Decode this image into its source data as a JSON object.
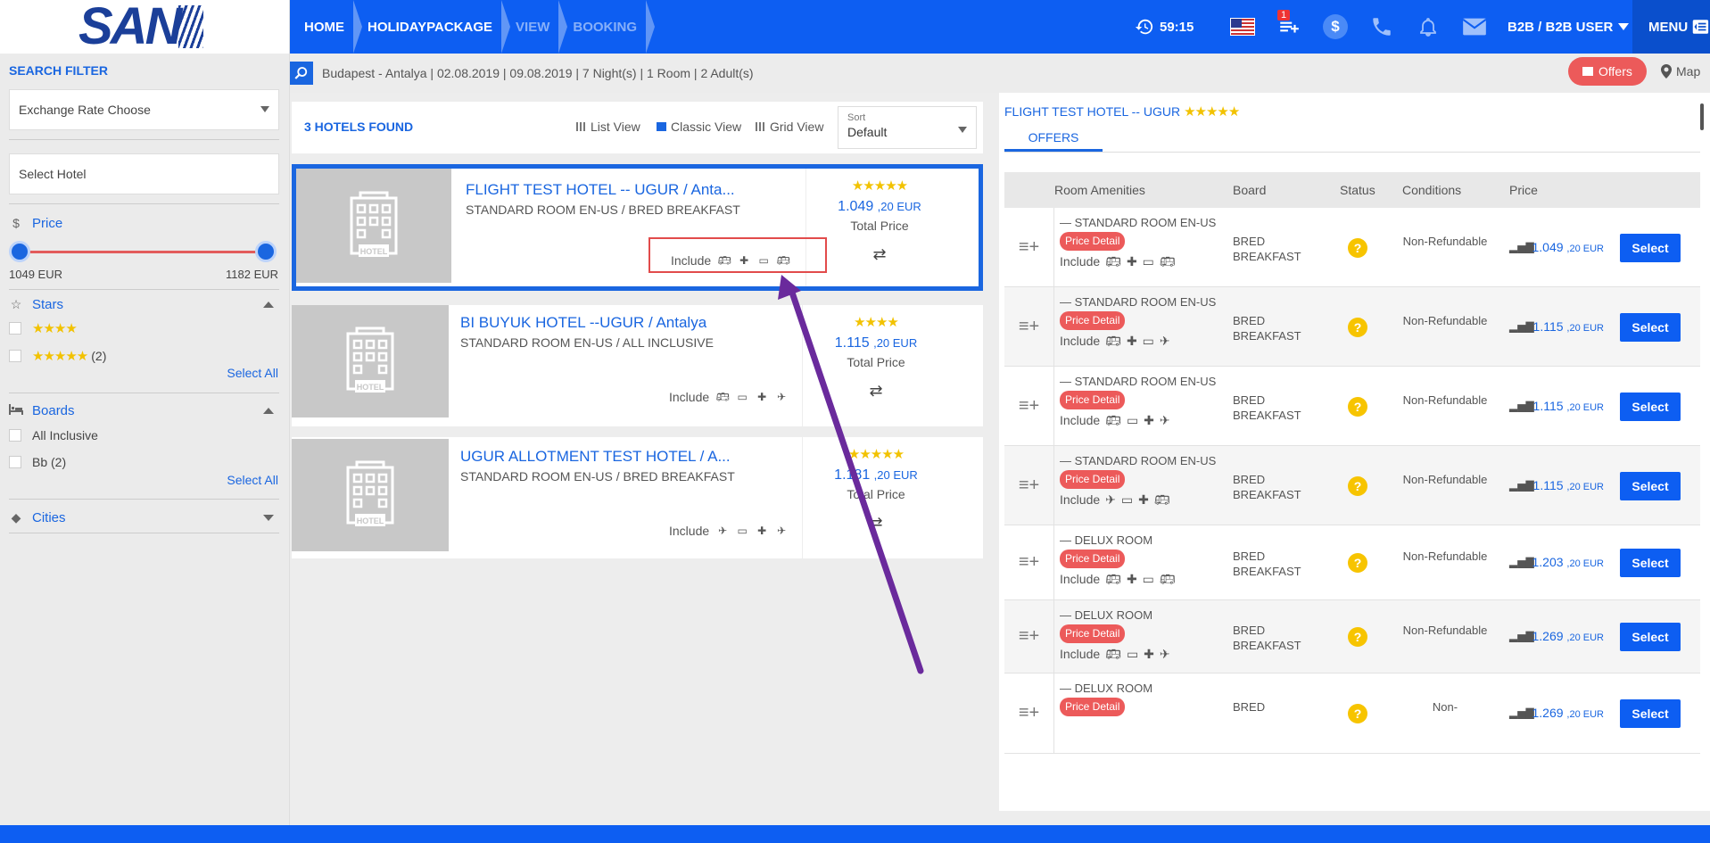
{
  "logo": "SAN",
  "breadcrumbs": [
    {
      "label": "HOME",
      "active": true
    },
    {
      "label": "HOLIDAYPACKAGE",
      "active": true
    },
    {
      "label": "VIEW",
      "active": false
    },
    {
      "label": "BOOKING",
      "active": false
    }
  ],
  "header": {
    "timer": "59:15",
    "cart_badge": "1",
    "user": "B2B / B2B USER",
    "menu": "MENU"
  },
  "sidebar": {
    "title": "SEARCH FILTER",
    "exchange_rate": "Exchange Rate Choose",
    "select_hotel": "Select Hotel",
    "price": {
      "label": "Price",
      "min": "1049 EUR",
      "max": "1182 EUR"
    },
    "stars": {
      "label": "Stars",
      "options": [
        {
          "stars": "★★★★",
          "count": ""
        },
        {
          "stars": "★★★★★",
          "count": "(2)"
        }
      ],
      "select_all": "Select All"
    },
    "boards": {
      "label": "Boards",
      "options": [
        {
          "label": "All Inclusive"
        },
        {
          "label": "Bb (2)"
        }
      ],
      "select_all": "Select All"
    },
    "cities": {
      "label": "Cities"
    }
  },
  "search_summary": "Budapest - Antalya | 02.08.2019 | 09.08.2019 | 7 Night(s) | 1 Room | 2 Adult(s)",
  "offers_button": "Offers",
  "map_button": "Map",
  "list": {
    "found": "3 HOTELS FOUND",
    "views": [
      "List View",
      "Classic View",
      "Grid View"
    ],
    "sort_label": "Sort",
    "sort_value": "Default",
    "include_label": "Include",
    "total_price": "Total Price",
    "hotel_placeholder": "HOTEL"
  },
  "hotels": [
    {
      "name": "FLIGHT TEST HOTEL -- UGUR / Anta...",
      "room": "STANDARD ROOM EN-US / BRED BREAKFAST",
      "stars": "★★★★★",
      "price": "1.049",
      "price_dec": ",20 EUR",
      "icons": [
        "bus-icon",
        "medical-icon",
        "van-icon",
        "bus-icon"
      ]
    },
    {
      "name": "BI BUYUK HOTEL --UGUR / Antalya",
      "room": "STANDARD ROOM EN-US / ALL INCLUSIVE",
      "stars": "★★★★",
      "price": "1.115",
      "price_dec": ",20 EUR",
      "icons": [
        "bus-icon",
        "van-icon",
        "medical-icon",
        "flight-icon"
      ]
    },
    {
      "name": "UGUR ALLOTMENT TEST HOTEL / A...",
      "room": "STANDARD ROOM EN-US / BRED BREAKFAST",
      "stars": "★★★★★",
      "price": "1.181",
      "price_dec": ",20 EUR",
      "icons": [
        "flight-icon",
        "van-icon",
        "medical-icon",
        "flight-icon"
      ]
    }
  ],
  "offers": {
    "hotel_title": "FLIGHT TEST HOTEL -- UGUR",
    "hotel_stars": "★★★★★",
    "tab": "OFFERS",
    "columns": [
      "Room Amenities",
      "Board",
      "Status",
      "Conditions",
      "Price"
    ],
    "price_detail": "Price Detail",
    "include_label": "Include",
    "select_label": "Select",
    "rows": [
      {
        "room": "STANDARD ROOM EN-US",
        "board": "BRED BREAKFAST",
        "conditions": "Non-Refundable",
        "price": "1.049",
        "dec": ",20 EUR",
        "icons": [
          "bus-icon",
          "medical-icon",
          "van-icon",
          "bus-icon"
        ]
      },
      {
        "room": "STANDARD ROOM EN-US",
        "board": "BRED BREAKFAST",
        "conditions": "Non-Refundable",
        "price": "1.115",
        "dec": ",20 EUR",
        "icons": [
          "bus-icon",
          "medical-icon",
          "van-icon",
          "flight-icon"
        ]
      },
      {
        "room": "STANDARD ROOM EN-US",
        "board": "BRED BREAKFAST",
        "conditions": "Non-Refundable",
        "price": "1.115",
        "dec": ",20 EUR",
        "icons": [
          "bus-icon",
          "van-icon",
          "medical-icon",
          "flight-icon"
        ]
      },
      {
        "room": "STANDARD ROOM EN-US",
        "board": "BRED BREAKFAST",
        "conditions": "Non-Refundable",
        "price": "1.115",
        "dec": ",20 EUR",
        "icons": [
          "flight-icon",
          "van-icon",
          "medical-icon",
          "bus-icon"
        ]
      },
      {
        "room": "DELUX ROOM",
        "board": "BRED BREAKFAST",
        "conditions": "Non-Refundable",
        "price": "1.203",
        "dec": ",20 EUR",
        "icons": [
          "bus-icon",
          "medical-icon",
          "van-icon",
          "bus-icon"
        ]
      },
      {
        "room": "DELUX ROOM",
        "board": "BRED BREAKFAST",
        "conditions": "Non-Refundable",
        "price": "1.269",
        "dec": ",20 EUR",
        "icons": [
          "bus-icon",
          "van-icon",
          "medical-icon",
          "flight-icon"
        ]
      },
      {
        "room": "DELUX ROOM",
        "board": "BRED",
        "conditions": "Non-",
        "price": "1.269",
        "dec": ",20 EUR",
        "icons": []
      }
    ]
  },
  "colors": {
    "brand": "#0d5ef2",
    "accent_red": "#ec5a5a",
    "star": "#f2c200",
    "annotation": "#6a2a9c"
  }
}
